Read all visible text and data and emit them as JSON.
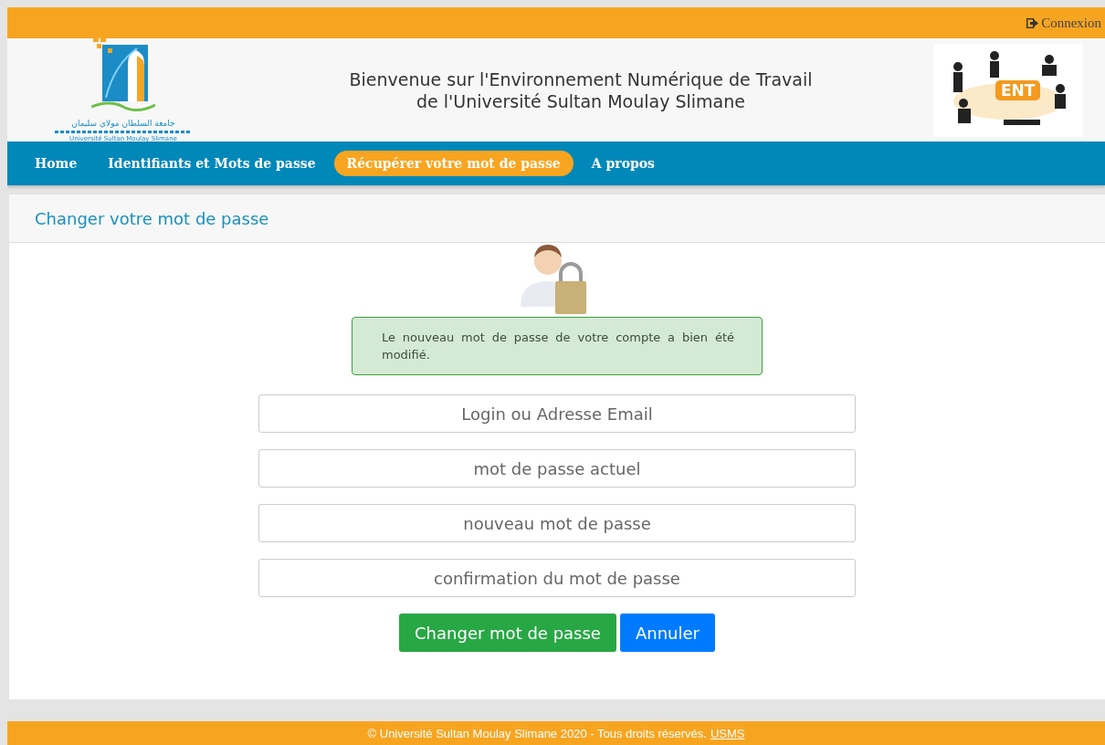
{
  "topbar": {
    "login_link": "Connexion"
  },
  "header": {
    "logo_caption_arabic": "جامعة السلطان مولاي سليمان",
    "logo_caption": "Université Sultan Moulay Slimane",
    "title_lines": [
      "Bienvenue sur l'Environnement Numérique de Travail",
      "de l'Université Sultan Moulay Slimane"
    ],
    "illustration_label": "ENT"
  },
  "nav": [
    {
      "label": "Home",
      "selected": false
    },
    {
      "label": "Identifiants et Mots de passe",
      "selected": false
    },
    {
      "label": "Récupérer votre mot de passe",
      "selected": true
    },
    {
      "label": "A propos",
      "selected": false
    }
  ],
  "card": {
    "title": "Changer votre mot de passe",
    "alert": "Le nouveau mot de passe de votre compte a bien été modifié.",
    "fields": [
      {
        "placeholder": "Login ou Adresse Email"
      },
      {
        "placeholder": "mot de passe actuel"
      },
      {
        "placeholder": "nouveau mot de passe"
      },
      {
        "placeholder": "confirmation du mot de passe"
      }
    ],
    "buttons": [
      {
        "label": "Changer mot de passe",
        "kind": "success"
      },
      {
        "label": "Annuler",
        "kind": "primary"
      }
    ]
  },
  "footer": {
    "text": "© Université Sultan Moulay Slimane 2020 - Tous droits réservés.",
    "link": "USMS"
  }
}
